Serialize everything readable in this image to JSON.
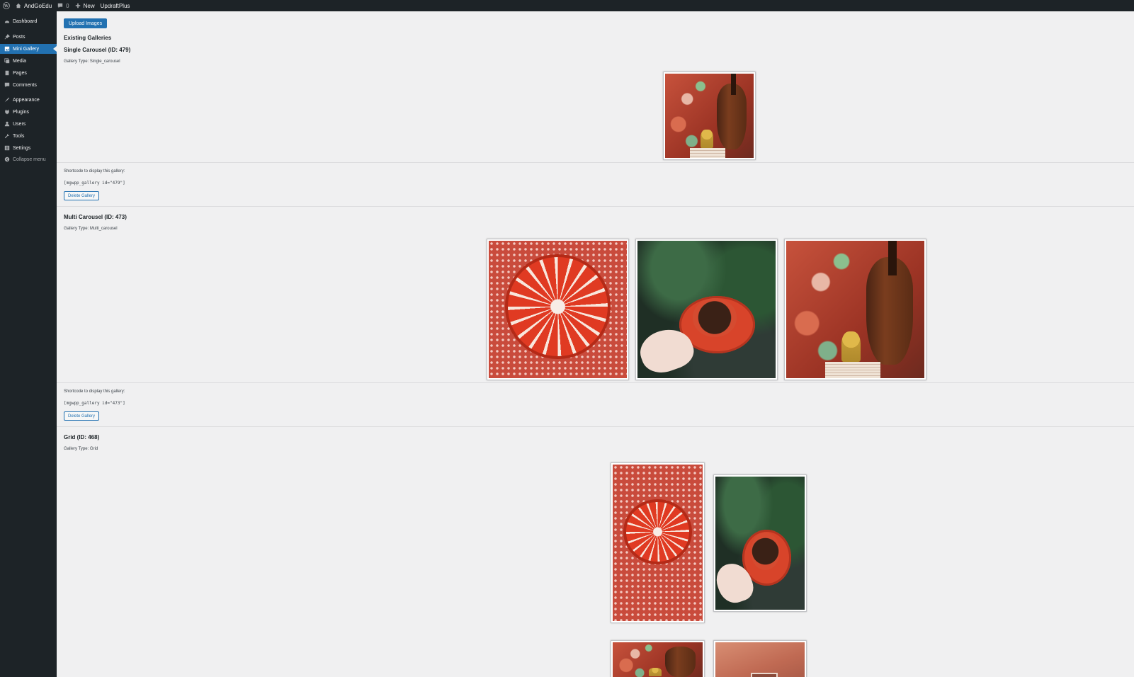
{
  "admin_bar": {
    "site_name": "AndGoEdu",
    "comments_count": "0",
    "new_label": "New",
    "plugin_label": "UpdraftPlus"
  },
  "sidebar": {
    "items": [
      {
        "label": "Dashboard",
        "icon": "dashboard-icon"
      },
      {
        "label": "Posts",
        "icon": "pin-icon"
      },
      {
        "label": "Mini Gallery",
        "icon": "gallery-icon",
        "active": true
      },
      {
        "label": "Media",
        "icon": "media-icon"
      },
      {
        "label": "Pages",
        "icon": "pages-icon"
      },
      {
        "label": "Comments",
        "icon": "comment-icon"
      },
      {
        "label": "Appearance",
        "icon": "brush-icon"
      },
      {
        "label": "Plugins",
        "icon": "plug-icon"
      },
      {
        "label": "Users",
        "icon": "user-icon"
      },
      {
        "label": "Tools",
        "icon": "wrench-icon"
      },
      {
        "label": "Settings",
        "icon": "settings-icon"
      },
      {
        "label": "Collapse menu",
        "icon": "collapse-icon"
      }
    ]
  },
  "main": {
    "upload_button": "Upload Images",
    "existing_heading": "Existing Galleries",
    "galleries": [
      {
        "title": "Single Carousel (ID: 479)",
        "type_label": "Gallery Type: Single_carousel",
        "shortcode_label": "Shortcode to display this gallery:",
        "shortcode": "[mgwpp_gallery id=\"479\"]",
        "delete_label": "Delete Gallery",
        "images": [
          "violin"
        ]
      },
      {
        "title": "Multi Carousel (ID: 473)",
        "type_label": "Gallery Type: Multi_carousel",
        "shortcode_label": "Shortcode to display this gallery:",
        "shortcode": "[mgwpp_gallery id=\"473\"]",
        "delete_label": "Delete Gallery",
        "images": [
          "pomegranate",
          "coffee",
          "violin"
        ]
      },
      {
        "title": "Grid (ID: 468)",
        "type_label": "Gallery Type: Grid",
        "images": [
          "pomegranate",
          "coffee",
          "violin",
          "wall"
        ]
      }
    ]
  },
  "colors": {
    "admin_dark": "#1d2327",
    "accent": "#2271b1",
    "background": "#f0f0f1"
  }
}
